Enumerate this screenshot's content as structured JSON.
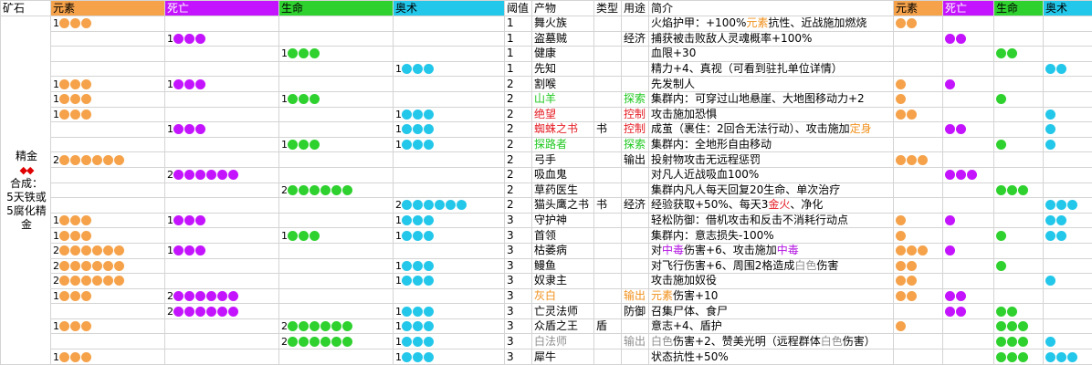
{
  "colors": {
    "element": "#f5a24a",
    "death": "#c414ff",
    "life": "#2ed12e",
    "arcane": "#22c7ea",
    "element_text": "#f0901c",
    "red_text": "#e51c23",
    "green_text": "#1ec81e",
    "purple_text": "#b214e0",
    "gray_text": "#8f8f8f"
  },
  "header": {
    "ore": "矿石",
    "element": "元素",
    "death": "死亡",
    "life": "生命",
    "arcane": "奥术",
    "threshold": "阈值",
    "product": "产物",
    "type": "类型",
    "use": "用途",
    "desc": "简介",
    "element2": "元素",
    "death2": "死亡",
    "life2": "生命",
    "arcane2": "奥术"
  },
  "ore": {
    "name": "精金",
    "diamonds": "◆◆",
    "synth_label": "合成：",
    "synth_recipe": "5天铁或5腐化精金"
  },
  "rows": [
    {
      "el": 1,
      "de": 0,
      "li": 0,
      "ar": 0,
      "thr": "1",
      "prod": [
        [
          "舞火族",
          ""
        ]
      ],
      "type": "",
      "use": [
        [
          "",
          ""
        ]
      ],
      "desc": [
        [
          "火焰护甲：+100%",
          ""
        ],
        [
          "元素",
          "orange"
        ],
        [
          "抗性、近战施加燃烧",
          ""
        ]
      ],
      "r": [
        2,
        0,
        0,
        0
      ]
    },
    {
      "el": 0,
      "de": 1,
      "li": 0,
      "ar": 0,
      "thr": "1",
      "prod": [
        [
          "盗墓贼",
          ""
        ]
      ],
      "type": "",
      "use": [
        [
          "经济",
          ""
        ]
      ],
      "desc": [
        [
          "捕获被击败敌人灵魂概率+100%",
          ""
        ]
      ],
      "r": [
        0,
        2,
        0,
        0
      ]
    },
    {
      "el": 0,
      "de": 0,
      "li": 1,
      "ar": 0,
      "thr": "1",
      "prod": [
        [
          "健康",
          ""
        ]
      ],
      "type": "",
      "use": [
        [
          "",
          ""
        ]
      ],
      "desc": [
        [
          "血限+30",
          ""
        ]
      ],
      "r": [
        0,
        0,
        2,
        0
      ]
    },
    {
      "el": 0,
      "de": 0,
      "li": 0,
      "ar": 1,
      "thr": "1",
      "prod": [
        [
          "先知",
          ""
        ]
      ],
      "type": "",
      "use": [
        [
          "",
          ""
        ]
      ],
      "desc": [
        [
          "精力+4、真视（可看到驻扎单位详情）",
          ""
        ]
      ],
      "r": [
        0,
        0,
        0,
        2
      ]
    },
    {
      "el": 1,
      "de": 1,
      "li": 0,
      "ar": 0,
      "thr": "2",
      "prod": [
        [
          "割喉",
          ""
        ]
      ],
      "type": "",
      "use": [
        [
          "",
          ""
        ]
      ],
      "desc": [
        [
          "先发制人",
          ""
        ]
      ],
      "r": [
        1,
        1,
        0,
        0
      ]
    },
    {
      "el": 1,
      "de": 0,
      "li": 1,
      "ar": 0,
      "thr": "2",
      "prod": [
        [
          "山羊",
          "green"
        ]
      ],
      "type": "",
      "use": [
        [
          "探索",
          "green"
        ]
      ],
      "desc": [
        [
          "集群内：可穿过山地悬崖、大地图移动力+2",
          ""
        ]
      ],
      "r": [
        1,
        0,
        1,
        0
      ]
    },
    {
      "el": 1,
      "de": 0,
      "li": 0,
      "ar": 1,
      "thr": "2",
      "prod": [
        [
          "绝望",
          "red"
        ]
      ],
      "type": "",
      "use": [
        [
          "控制",
          "red"
        ]
      ],
      "desc": [
        [
          "攻击施加恐惧",
          ""
        ]
      ],
      "r": [
        2,
        0,
        0,
        1
      ]
    },
    {
      "el": 0,
      "de": 1,
      "li": 0,
      "ar": 1,
      "thr": "2",
      "prod": [
        [
          "蜘蛛之书",
          "red"
        ]
      ],
      "type": "书",
      "use": [
        [
          "控制",
          "red"
        ]
      ],
      "desc": [
        [
          "成茧（裹住：2回合无法行动）、攻击施加",
          ""
        ],
        [
          "定身",
          "orange"
        ]
      ],
      "r": [
        0,
        2,
        0,
        1
      ]
    },
    {
      "el": 0,
      "de": 0,
      "li": 1,
      "ar": 1,
      "thr": "2",
      "prod": [
        [
          "探路者",
          "green"
        ]
      ],
      "type": "",
      "use": [
        [
          "探索",
          "green"
        ]
      ],
      "desc": [
        [
          "集群内：全地形自由移动",
          ""
        ]
      ],
      "r": [
        0,
        0,
        1,
        1
      ]
    },
    {
      "el": 2,
      "de": 0,
      "li": 0,
      "ar": 0,
      "thr": "2",
      "prod": [
        [
          "弓手",
          ""
        ]
      ],
      "type": "",
      "use": [
        [
          "输出",
          ""
        ]
      ],
      "desc": [
        [
          "投射物攻击无远程惩罚",
          ""
        ]
      ],
      "r": [
        3,
        0,
        0,
        0
      ]
    },
    {
      "el": 0,
      "de": 2,
      "li": 0,
      "ar": 0,
      "thr": "2",
      "prod": [
        [
          "吸血鬼",
          ""
        ]
      ],
      "type": "",
      "use": [
        [
          "",
          ""
        ]
      ],
      "desc": [
        [
          "对凡人近战吸血100%",
          ""
        ]
      ],
      "r": [
        0,
        3,
        0,
        0
      ]
    },
    {
      "el": 0,
      "de": 0,
      "li": 2,
      "ar": 0,
      "thr": "2",
      "prod": [
        [
          "草药医生",
          ""
        ]
      ],
      "type": "",
      "use": [
        [
          "",
          ""
        ]
      ],
      "desc": [
        [
          "集群内凡人每天回复20生命、单次治疗",
          ""
        ]
      ],
      "r": [
        0,
        0,
        3,
        0
      ]
    },
    {
      "el": 0,
      "de": 0,
      "li": 0,
      "ar": 2,
      "thr": "2",
      "prod": [
        [
          "猫头鹰之书",
          ""
        ]
      ],
      "type": "书",
      "use": [
        [
          "经济",
          ""
        ]
      ],
      "desc": [
        [
          "经验获取+50%、每天3",
          ""
        ],
        [
          "金火",
          "red"
        ],
        [
          "、净化",
          ""
        ]
      ],
      "r": [
        0,
        0,
        0,
        3
      ]
    },
    {
      "el": 1,
      "de": 1,
      "li": 0,
      "ar": 1,
      "thr": "3",
      "prod": [
        [
          "守护神",
          ""
        ]
      ],
      "type": "",
      "use": [
        [
          "",
          ""
        ]
      ],
      "desc": [
        [
          "轻松防御：借机攻击和反击不消耗行动点",
          ""
        ]
      ],
      "r": [
        1,
        1,
        0,
        2
      ]
    },
    {
      "el": 1,
      "de": 0,
      "li": 1,
      "ar": 1,
      "thr": "3",
      "prod": [
        [
          "首领",
          ""
        ]
      ],
      "type": "",
      "use": [
        [
          "",
          ""
        ]
      ],
      "desc": [
        [
          "集群内：意志损失-100%",
          ""
        ]
      ],
      "r": [
        1,
        0,
        1,
        2
      ]
    },
    {
      "el": 2,
      "de": 1,
      "li": 0,
      "ar": 0,
      "thr": "3",
      "prod": [
        [
          "枯萎病",
          ""
        ]
      ],
      "type": "",
      "use": [
        [
          "",
          ""
        ]
      ],
      "desc": [
        [
          "对",
          ""
        ],
        [
          "中毒",
          "purple"
        ],
        [
          "伤害+6、攻击施加",
          ""
        ],
        [
          "中毒",
          "purple"
        ]
      ],
      "r": [
        3,
        1,
        0,
        0
      ]
    },
    {
      "el": 2,
      "de": 0,
      "li": 0,
      "ar": 1,
      "thr": "3",
      "prod": [
        [
          "鳗鱼",
          ""
        ]
      ],
      "type": "",
      "use": [
        [
          "",
          ""
        ]
      ],
      "desc": [
        [
          "对飞行伤害+6、周围2格造成",
          ""
        ],
        [
          "白色",
          "gray"
        ],
        [
          "伤害",
          ""
        ]
      ],
      "r": [
        2,
        0,
        1,
        0
      ]
    },
    {
      "el": 2,
      "de": 0,
      "li": 0,
      "ar": 1,
      "thr": "3",
      "prod": [
        [
          "奴隶主",
          ""
        ]
      ],
      "type": "",
      "use": [
        [
          "",
          ""
        ]
      ],
      "desc": [
        [
          "攻击施加奴役",
          ""
        ]
      ],
      "r": [
        2,
        0,
        0,
        1
      ]
    },
    {
      "el": 1,
      "de": 2,
      "li": 0,
      "ar": 0,
      "thr": "3",
      "prod": [
        [
          "灰白",
          "orange"
        ]
      ],
      "type": "",
      "use": [
        [
          "输出",
          "orange"
        ]
      ],
      "desc": [
        [
          "元素",
          "orange"
        ],
        [
          "伤害+10",
          ""
        ]
      ],
      "r": [
        2,
        2,
        0,
        0
      ]
    },
    {
      "el": 0,
      "de": 2,
      "li": 0,
      "ar": 1,
      "thr": "3",
      "prod": [
        [
          "亡灵法师",
          ""
        ]
      ],
      "type": "",
      "use": [
        [
          "防御",
          ""
        ]
      ],
      "desc": [
        [
          "召集尸体、食尸",
          ""
        ]
      ],
      "r": [
        0,
        2,
        2,
        0
      ]
    },
    {
      "el": 1,
      "de": 0,
      "li": 2,
      "ar": 1,
      "thr": "3",
      "prod": [
        [
          "众盾之王",
          ""
        ]
      ],
      "type": "盾",
      "use": [
        [
          "",
          ""
        ]
      ],
      "desc": [
        [
          "意志+4、盾护",
          ""
        ]
      ],
      "r": [
        1,
        0,
        3,
        0
      ]
    },
    {
      "el": 0,
      "de": 0,
      "li": 2,
      "ar": 1,
      "thr": "3",
      "prod": [
        [
          "白法师",
          "gray"
        ]
      ],
      "type": "",
      "use": [
        [
          "输出",
          "gray"
        ]
      ],
      "desc": [
        [
          "白色",
          "gray"
        ],
        [
          "伤害+2、赞美光明（远程群体",
          ""
        ],
        [
          "白色",
          "gray"
        ],
        [
          "伤害）",
          ""
        ]
      ],
      "r": [
        0,
        0,
        3,
        1
      ]
    },
    {
      "el": 1,
      "de": 0,
      "li": 0,
      "ar": 1,
      "thr": "3",
      "prod": [
        [
          "犀牛",
          ""
        ]
      ],
      "type": "",
      "use": [
        [
          "",
          ""
        ]
      ],
      "desc": [
        [
          "状态抗性+50%",
          ""
        ]
      ],
      "r": [
        0,
        0,
        3,
        3
      ]
    }
  ],
  "row_counts": {
    "left": [
      [
        1,
        0,
        0,
        0
      ],
      [
        0,
        1,
        0,
        0
      ],
      [
        0,
        0,
        1,
        0
      ],
      [
        0,
        0,
        0,
        1
      ],
      [
        1,
        1,
        0,
        0
      ],
      [
        1,
        0,
        1,
        0
      ],
      [
        1,
        0,
        0,
        1
      ],
      [
        0,
        1,
        0,
        1
      ],
      [
        0,
        0,
        1,
        1
      ],
      [
        2,
        0,
        0,
        0
      ],
      [
        0,
        2,
        0,
        0
      ],
      [
        0,
        0,
        2,
        0
      ],
      [
        0,
        0,
        0,
        2
      ],
      [
        1,
        1,
        0,
        1
      ],
      [
        1,
        0,
        1,
        1
      ],
      [
        2,
        1,
        0,
        0
      ],
      [
        2,
        0,
        0,
        1
      ],
      [
        2,
        0,
        0,
        1
      ],
      [
        1,
        2,
        0,
        0
      ],
      [
        0,
        2,
        0,
        1
      ],
      [
        1,
        0,
        2,
        1
      ],
      [
        0,
        0,
        2,
        1
      ],
      [
        1,
        0,
        0,
        1
      ]
    ],
    "left_dots": [
      [
        3,
        0,
        0,
        0
      ],
      [
        0,
        3,
        0,
        0
      ],
      [
        0,
        0,
        3,
        0
      ],
      [
        0,
        0,
        0,
        3
      ],
      [
        3,
        3,
        0,
        0
      ],
      [
        3,
        0,
        3,
        0
      ],
      [
        3,
        0,
        0,
        3
      ],
      [
        0,
        3,
        0,
        3
      ],
      [
        0,
        0,
        3,
        3
      ],
      [
        6,
        0,
        0,
        0
      ],
      [
        0,
        6,
        0,
        0
      ],
      [
        0,
        0,
        6,
        0
      ],
      [
        0,
        0,
        0,
        6
      ],
      [
        3,
        3,
        0,
        3
      ],
      [
        3,
        0,
        3,
        3
      ],
      [
        6,
        3,
        0,
        0
      ],
      [
        6,
        0,
        0,
        3
      ],
      [
        6,
        0,
        0,
        3
      ],
      [
        3,
        6,
        0,
        0
      ],
      [
        0,
        6,
        0,
        3
      ],
      [
        3,
        0,
        6,
        3
      ],
      [
        0,
        0,
        6,
        3
      ],
      [
        3,
        0,
        0,
        3
      ]
    ]
  }
}
